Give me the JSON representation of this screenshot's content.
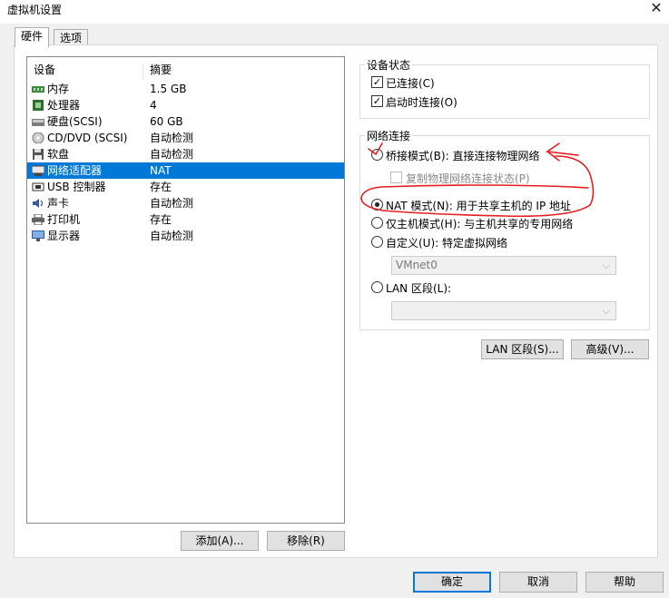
{
  "window": {
    "title": "虚拟机设置"
  },
  "tabs": [
    {
      "label": "硬件"
    },
    {
      "label": "选项"
    }
  ],
  "device_list": {
    "columns": {
      "device": "设备",
      "summary": "摘要"
    },
    "rows": [
      {
        "device": "内存",
        "summary": "1.5 GB",
        "icon": "memory-icon"
      },
      {
        "device": "处理器",
        "summary": "4",
        "icon": "processor-icon"
      },
      {
        "device": "硬盘(SCSI)",
        "summary": "60 GB",
        "icon": "hard-disk-icon"
      },
      {
        "device": "CD/DVD (SCSI)",
        "summary": "自动检测",
        "icon": "cd-dvd-icon"
      },
      {
        "device": "软盘",
        "summary": "自动检测",
        "icon": "floppy-icon"
      },
      {
        "device": "网络适配器",
        "summary": "NAT",
        "icon": "network-adapter-icon",
        "selected": true
      },
      {
        "device": "USB 控制器",
        "summary": "存在",
        "icon": "usb-icon"
      },
      {
        "device": "声卡",
        "summary": "自动检测",
        "icon": "sound-card-icon"
      },
      {
        "device": "打印机",
        "summary": "存在",
        "icon": "printer-icon"
      },
      {
        "device": "显示器",
        "summary": "自动检测",
        "icon": "display-icon"
      }
    ]
  },
  "device_status": {
    "legend": "设备状态",
    "connected": {
      "label": "已连接(C)",
      "checked": true
    },
    "connect_at_power_on": {
      "label": "启动时连接(O)",
      "checked": true
    }
  },
  "network_connection": {
    "legend": "网络连接",
    "bridged": {
      "label": "桥接模式(B): 直接连接物理网络",
      "selected": false
    },
    "replicate_state": {
      "label": "复制物理网络连接状态(P)",
      "checked": false,
      "enabled": false
    },
    "nat": {
      "label": "NAT 模式(N): 用于共享主机的 IP 地址",
      "selected": true
    },
    "host_only": {
      "label": "仅主机模式(H): 与主机共享的专用网络",
      "selected": false
    },
    "custom": {
      "label": "自定义(U): 特定虚拟网络",
      "selected": false,
      "select_value": "VMnet0"
    },
    "lan_segment": {
      "label": "LAN 区段(L):",
      "selected": false,
      "select_value": ""
    }
  },
  "buttons": {
    "lan_segments": "LAN 区段(S)...",
    "advanced": "高级(V)...",
    "add": "添加(A)...",
    "remove": "移除(R)",
    "ok": "确定",
    "cancel": "取消",
    "help": "帮助"
  },
  "colors": {
    "selection": "#0078d7",
    "annotation": "#e41e1e"
  }
}
